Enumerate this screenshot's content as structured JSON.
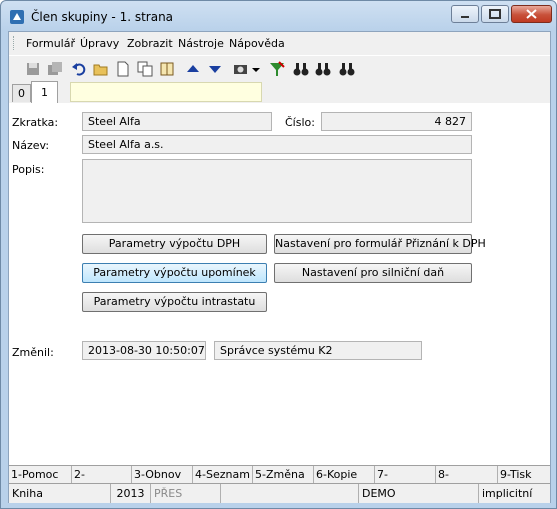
{
  "window": {
    "title": "Člen skupiny - 1. strana"
  },
  "menu": [
    "Formulář",
    "Úpravy",
    "Zobrazit",
    "Nástroje",
    "Nápověda"
  ],
  "toolbar": [
    "save-icon",
    "save-all-icon",
    "undo-icon",
    "open-folder-icon",
    "new-document-icon",
    "copy-icon",
    "book-icon",
    "arrow-up-icon",
    "arrow-down-icon",
    "camera-icon",
    "dropdown-arrow-icon",
    "filter-icon",
    "binoculars-icon",
    "binoculars-next-icon",
    "binoculars-prev-icon"
  ],
  "tabs": {
    "t0": "0",
    "t1": "1"
  },
  "form": {
    "zkratka_label": "Zkratka:",
    "zkratka_value": "Steel Alfa",
    "cislo_label": "Číslo:",
    "cislo_value": "4 827",
    "nazev_label": "Název:",
    "nazev_value": "Steel Alfa a.s.",
    "popis_label": "Popis:",
    "popis_value": "",
    "zmenil_label": "Změnil:",
    "zmenil_date": "2013-08-30 10:50:07",
    "zmenil_user": "Správce systému K2"
  },
  "buttons": {
    "dph": "Parametry výpočtu DPH",
    "priznani": "Nastavení pro formulář Přiznání k DPH",
    "upominky": "Parametry výpočtu upomínek",
    "silnicni": "Nastavení pro silniční daň",
    "intrastat": "Parametry výpočtu intrastatu"
  },
  "fkeys": [
    "1-Pomoc",
    "2-",
    "3-Obnov",
    "4-Seznam",
    "5-Změna",
    "6-Kopie",
    "7-",
    "8-",
    "9-Tisk"
  ],
  "status": {
    "book": "Kniha",
    "year": "2013",
    "mode": "PŘES",
    "db": "DEMO",
    "view": "implicitní"
  },
  "colors": {
    "title_bar": "#b9d1ea",
    "close_button": "#c8513a",
    "tab_strip": "#ffffe0"
  }
}
